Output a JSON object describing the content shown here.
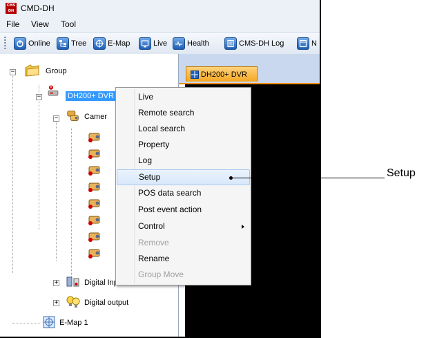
{
  "window": {
    "title": "CMD-DH",
    "logo_text": "CMS DH"
  },
  "menu": {
    "items": [
      "File",
      "View",
      "Tool"
    ]
  },
  "toolbar": {
    "buttons": [
      {
        "label": "Online",
        "icon": "power-icon"
      },
      {
        "label": "Tree",
        "icon": "tree-icon"
      },
      {
        "label": "E-Map",
        "icon": "map-icon"
      },
      {
        "label": "Live",
        "icon": "live-icon"
      },
      {
        "label": "Health",
        "icon": "health-icon"
      },
      {
        "label": "CMS-DH Log",
        "icon": "log-icon"
      },
      {
        "label": "N",
        "icon": "window-icon"
      }
    ]
  },
  "tree": {
    "root": "Group",
    "dvr": "DH200+ DVR",
    "cameras_group": "Camer",
    "camera_count": 8,
    "digital_input": "Digital Input",
    "digital_output": "Digital output",
    "emap": "E-Map 1"
  },
  "tab": {
    "label": "DH200+ DVR"
  },
  "context_menu": {
    "items": [
      {
        "label": "Live",
        "enabled": true
      },
      {
        "label": "Remote search",
        "enabled": true
      },
      {
        "label": "Local search",
        "enabled": true
      },
      {
        "label": "Property",
        "enabled": true
      },
      {
        "label": "Log",
        "enabled": true
      },
      {
        "label": "Setup",
        "enabled": true,
        "highlighted": true
      },
      {
        "label": "POS data search",
        "enabled": true
      },
      {
        "label": "Post event action",
        "enabled": true
      },
      {
        "label": "Control",
        "enabled": true,
        "submenu": true
      },
      {
        "label": "Remove",
        "enabled": false
      },
      {
        "label": "Rename",
        "enabled": true
      },
      {
        "label": "Group Move",
        "enabled": false
      }
    ]
  },
  "callout": {
    "label": "Setup"
  },
  "colors": {
    "selection": "#3399ff",
    "tab_accent": "#f5a623",
    "video_bg": "#000000",
    "menu_highlight": "#d8e8fb"
  }
}
